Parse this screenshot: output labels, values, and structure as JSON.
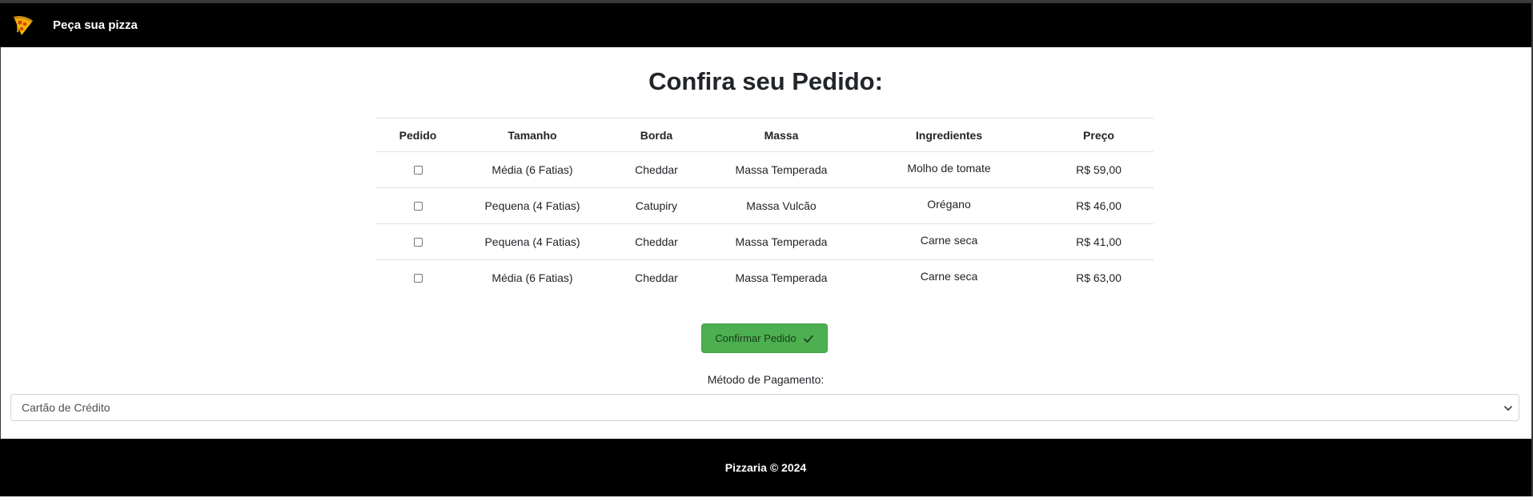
{
  "header": {
    "brand_name": "Peça sua pizza",
    "logo_icon": "pizza-slice-icon"
  },
  "main": {
    "title": "Confira seu Pedido:",
    "table": {
      "columns": [
        "Pedido",
        "Tamanho",
        "Borda",
        "Massa",
        "Ingredientes",
        "Preço"
      ],
      "rows": [
        {
          "checked": false,
          "tamanho": "Média (6 Fatias)",
          "borda": "Cheddar",
          "massa": "Massa Temperada",
          "ingredientes": "Molho de tomate",
          "preco": "R$ 59,00"
        },
        {
          "checked": false,
          "tamanho": "Pequena (4 Fatias)",
          "borda": "Catupiry",
          "massa": "Massa Vulcão",
          "ingredientes": "Orégano",
          "preco": "R$ 46,00"
        },
        {
          "checked": false,
          "tamanho": "Pequena (4 Fatias)",
          "borda": "Cheddar",
          "massa": "Massa Temperada",
          "ingredientes": "Carne seca",
          "preco": "R$ 41,00"
        },
        {
          "checked": false,
          "tamanho": "Média (6 Fatias)",
          "borda": "Cheddar",
          "massa": "Massa Temperada",
          "ingredientes": "Carne seca",
          "preco": "R$ 63,00"
        }
      ]
    },
    "confirm_button": {
      "label": "Confirmar Pedido",
      "icon": "check-icon",
      "color": "#4caf50"
    },
    "payment": {
      "label": "Método de Pagamento:",
      "selected": "Cartão de Crédito"
    }
  },
  "footer": {
    "text": "Pizzaria © 2024"
  }
}
